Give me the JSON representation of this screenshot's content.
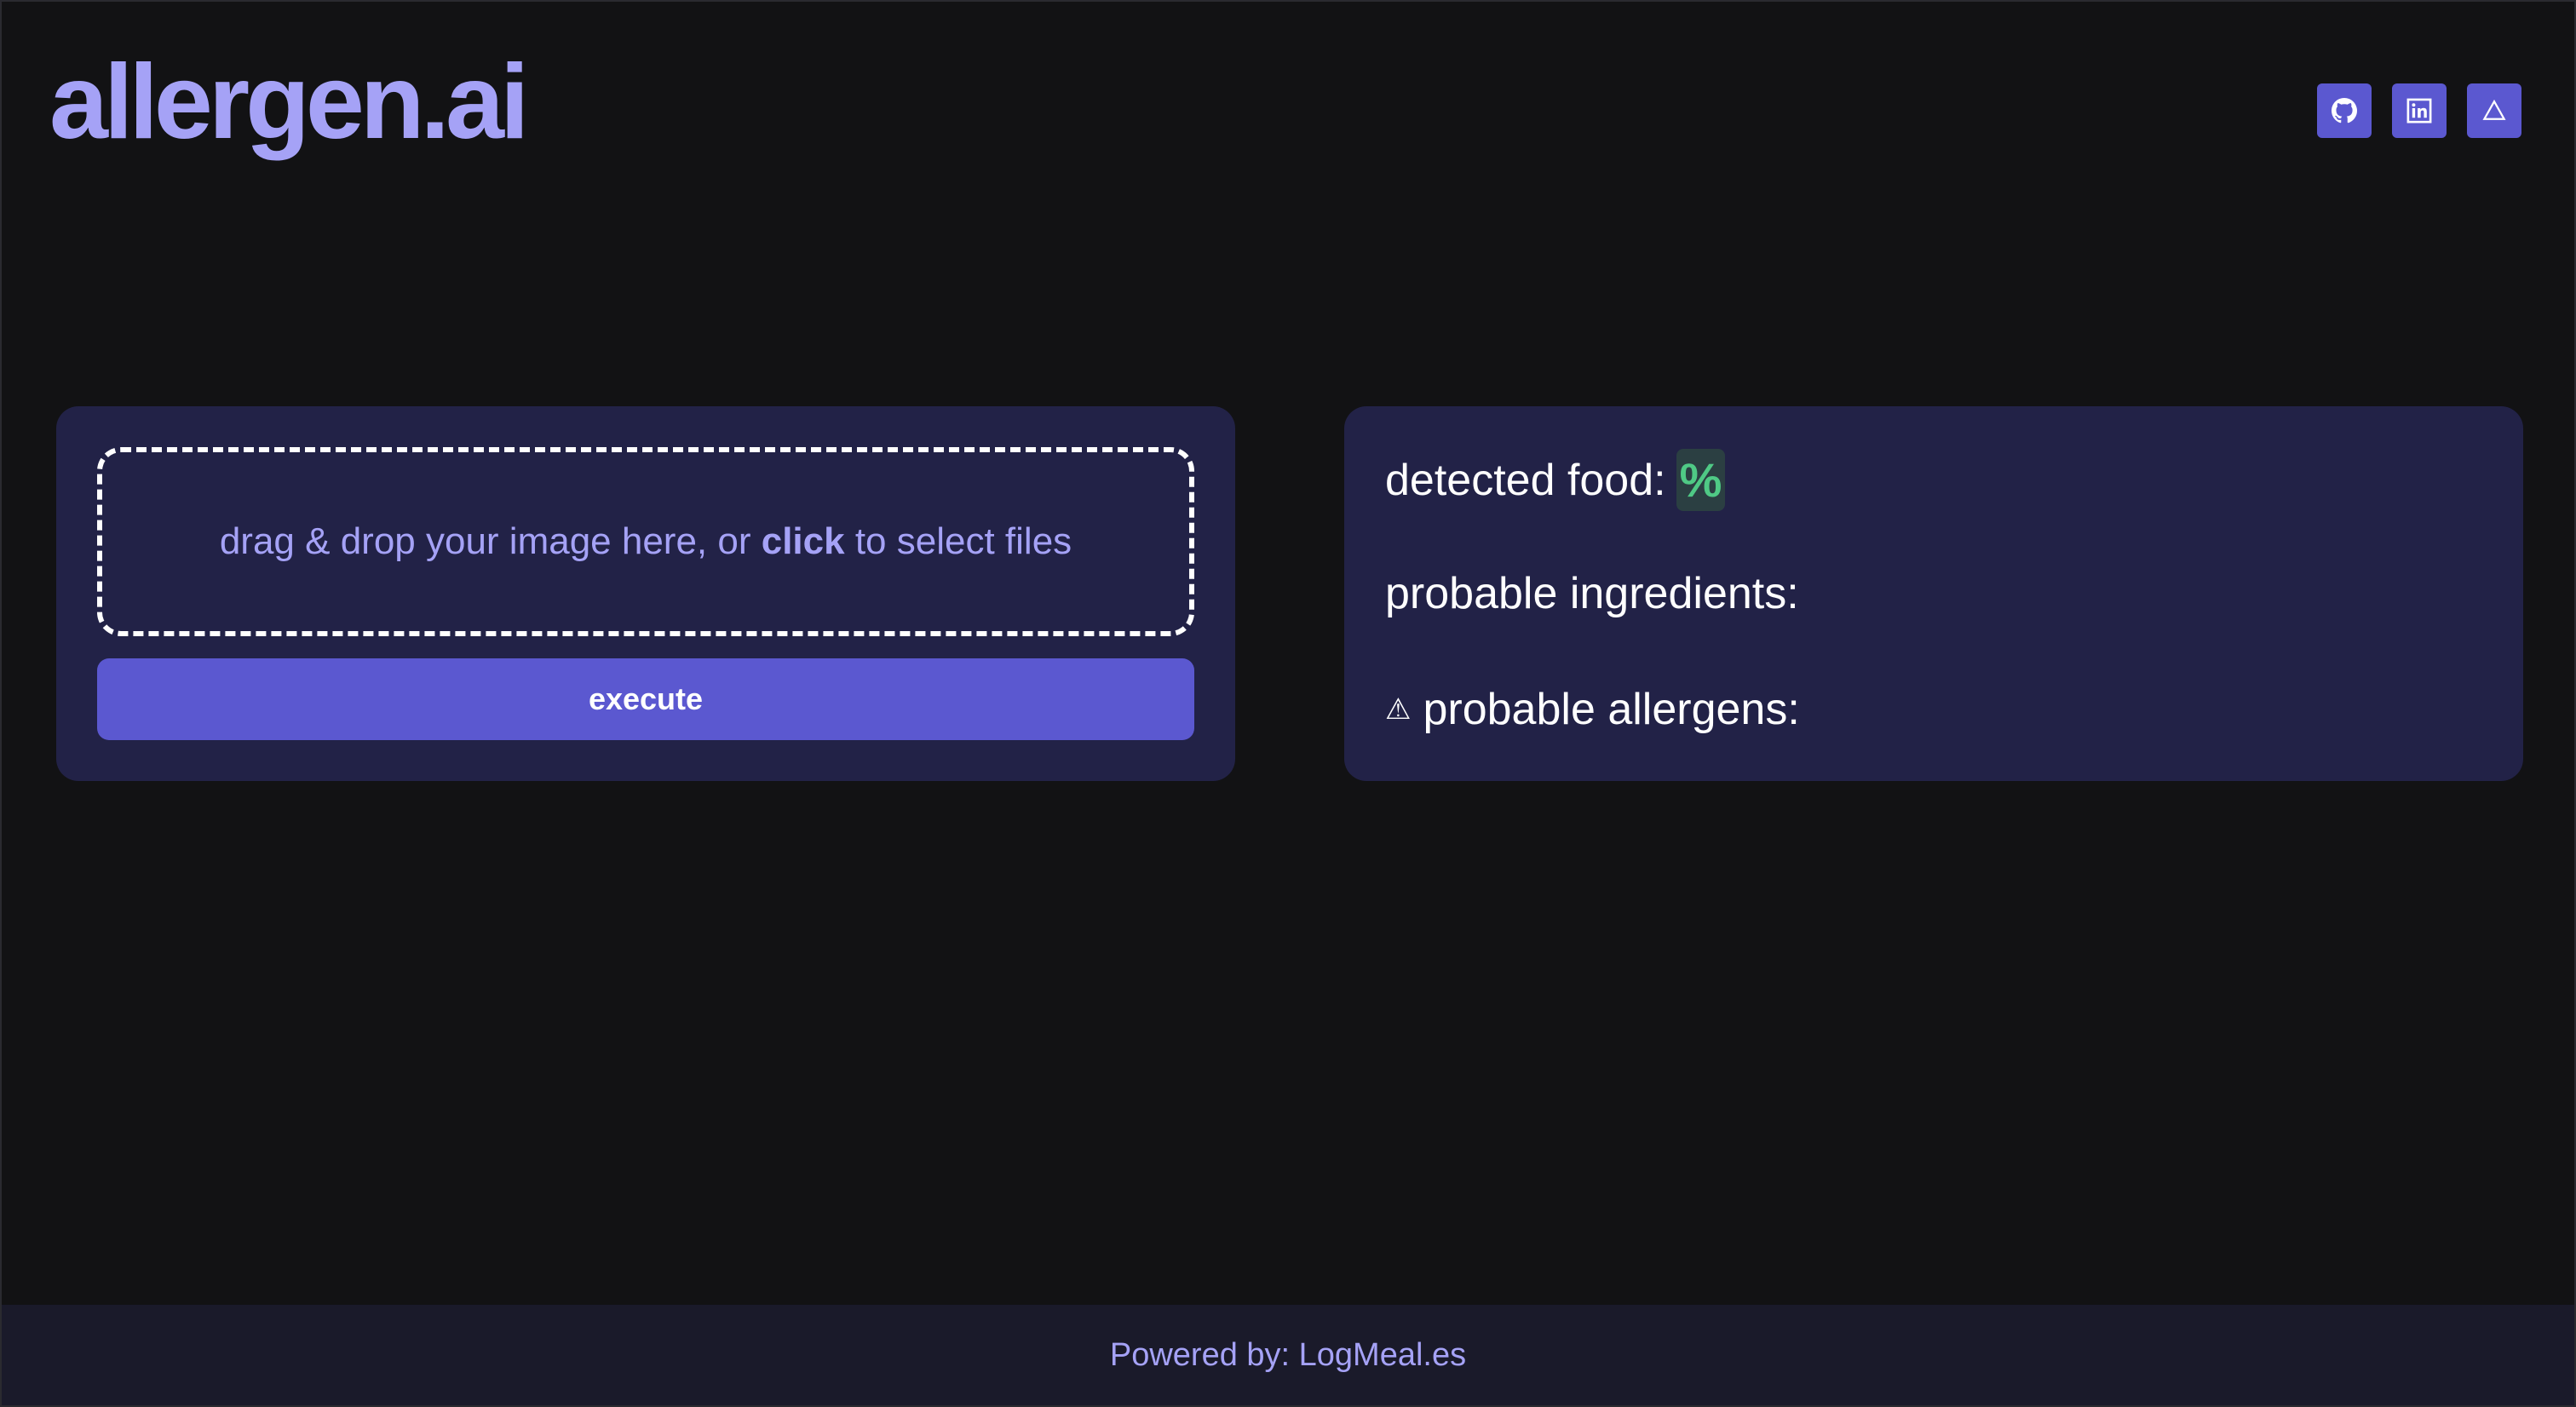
{
  "brand": {
    "logo_text": "allergen.ai"
  },
  "header_icons": [
    {
      "name": "github-icon"
    },
    {
      "name": "linkedin-icon"
    },
    {
      "name": "triangle-icon"
    }
  ],
  "upload": {
    "prefix": "drag & drop your image here, or ",
    "emphasis": "click",
    "suffix": " to select files",
    "execute_label": "execute"
  },
  "results": {
    "detected_food_label": "detected food:",
    "detected_food_value": "%",
    "ingredients_label": "probable ingredients:",
    "allergens_icon": "⚠",
    "allergens_label": "probable allergens:"
  },
  "footer": {
    "text": "Powered by: LogMeal.es"
  },
  "colors": {
    "background": "#121214",
    "panel": "#222247",
    "accent": "#5b58d0",
    "accent_text": "#a5a2f6",
    "success": "#4fc985"
  }
}
